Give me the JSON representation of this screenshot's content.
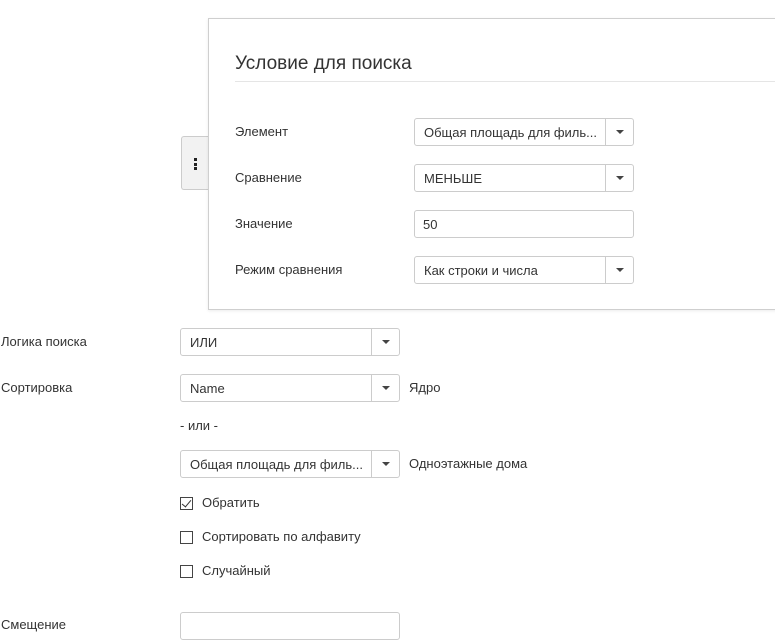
{
  "condition_panel": {
    "title": "Условие для поиска",
    "element_label": "Элемент",
    "element_value": "Общая площадь для филь...",
    "comparison_label": "Сравнение",
    "comparison_value": "МЕНЬШЕ",
    "value_label": "Значение",
    "value_input": "50",
    "mode_label": "Режим сравнения",
    "mode_value": "Как строки и числа"
  },
  "search_logic": {
    "label": "Логика поиска",
    "value": "ИЛИ"
  },
  "sorting": {
    "label": "Сортировка",
    "field_value": "Name",
    "field_note": "Ядро",
    "or_text": "- или -",
    "alt_value": "Общая площадь для филь...",
    "alt_note": "Одноэтажные дома",
    "reverse_label": "Обратить",
    "reverse_checked": true,
    "alpha_label": "Сортировать по алфавиту",
    "alpha_checked": false,
    "random_label": "Случайный",
    "random_checked": false
  },
  "next_row": {
    "label": "Смещение"
  }
}
